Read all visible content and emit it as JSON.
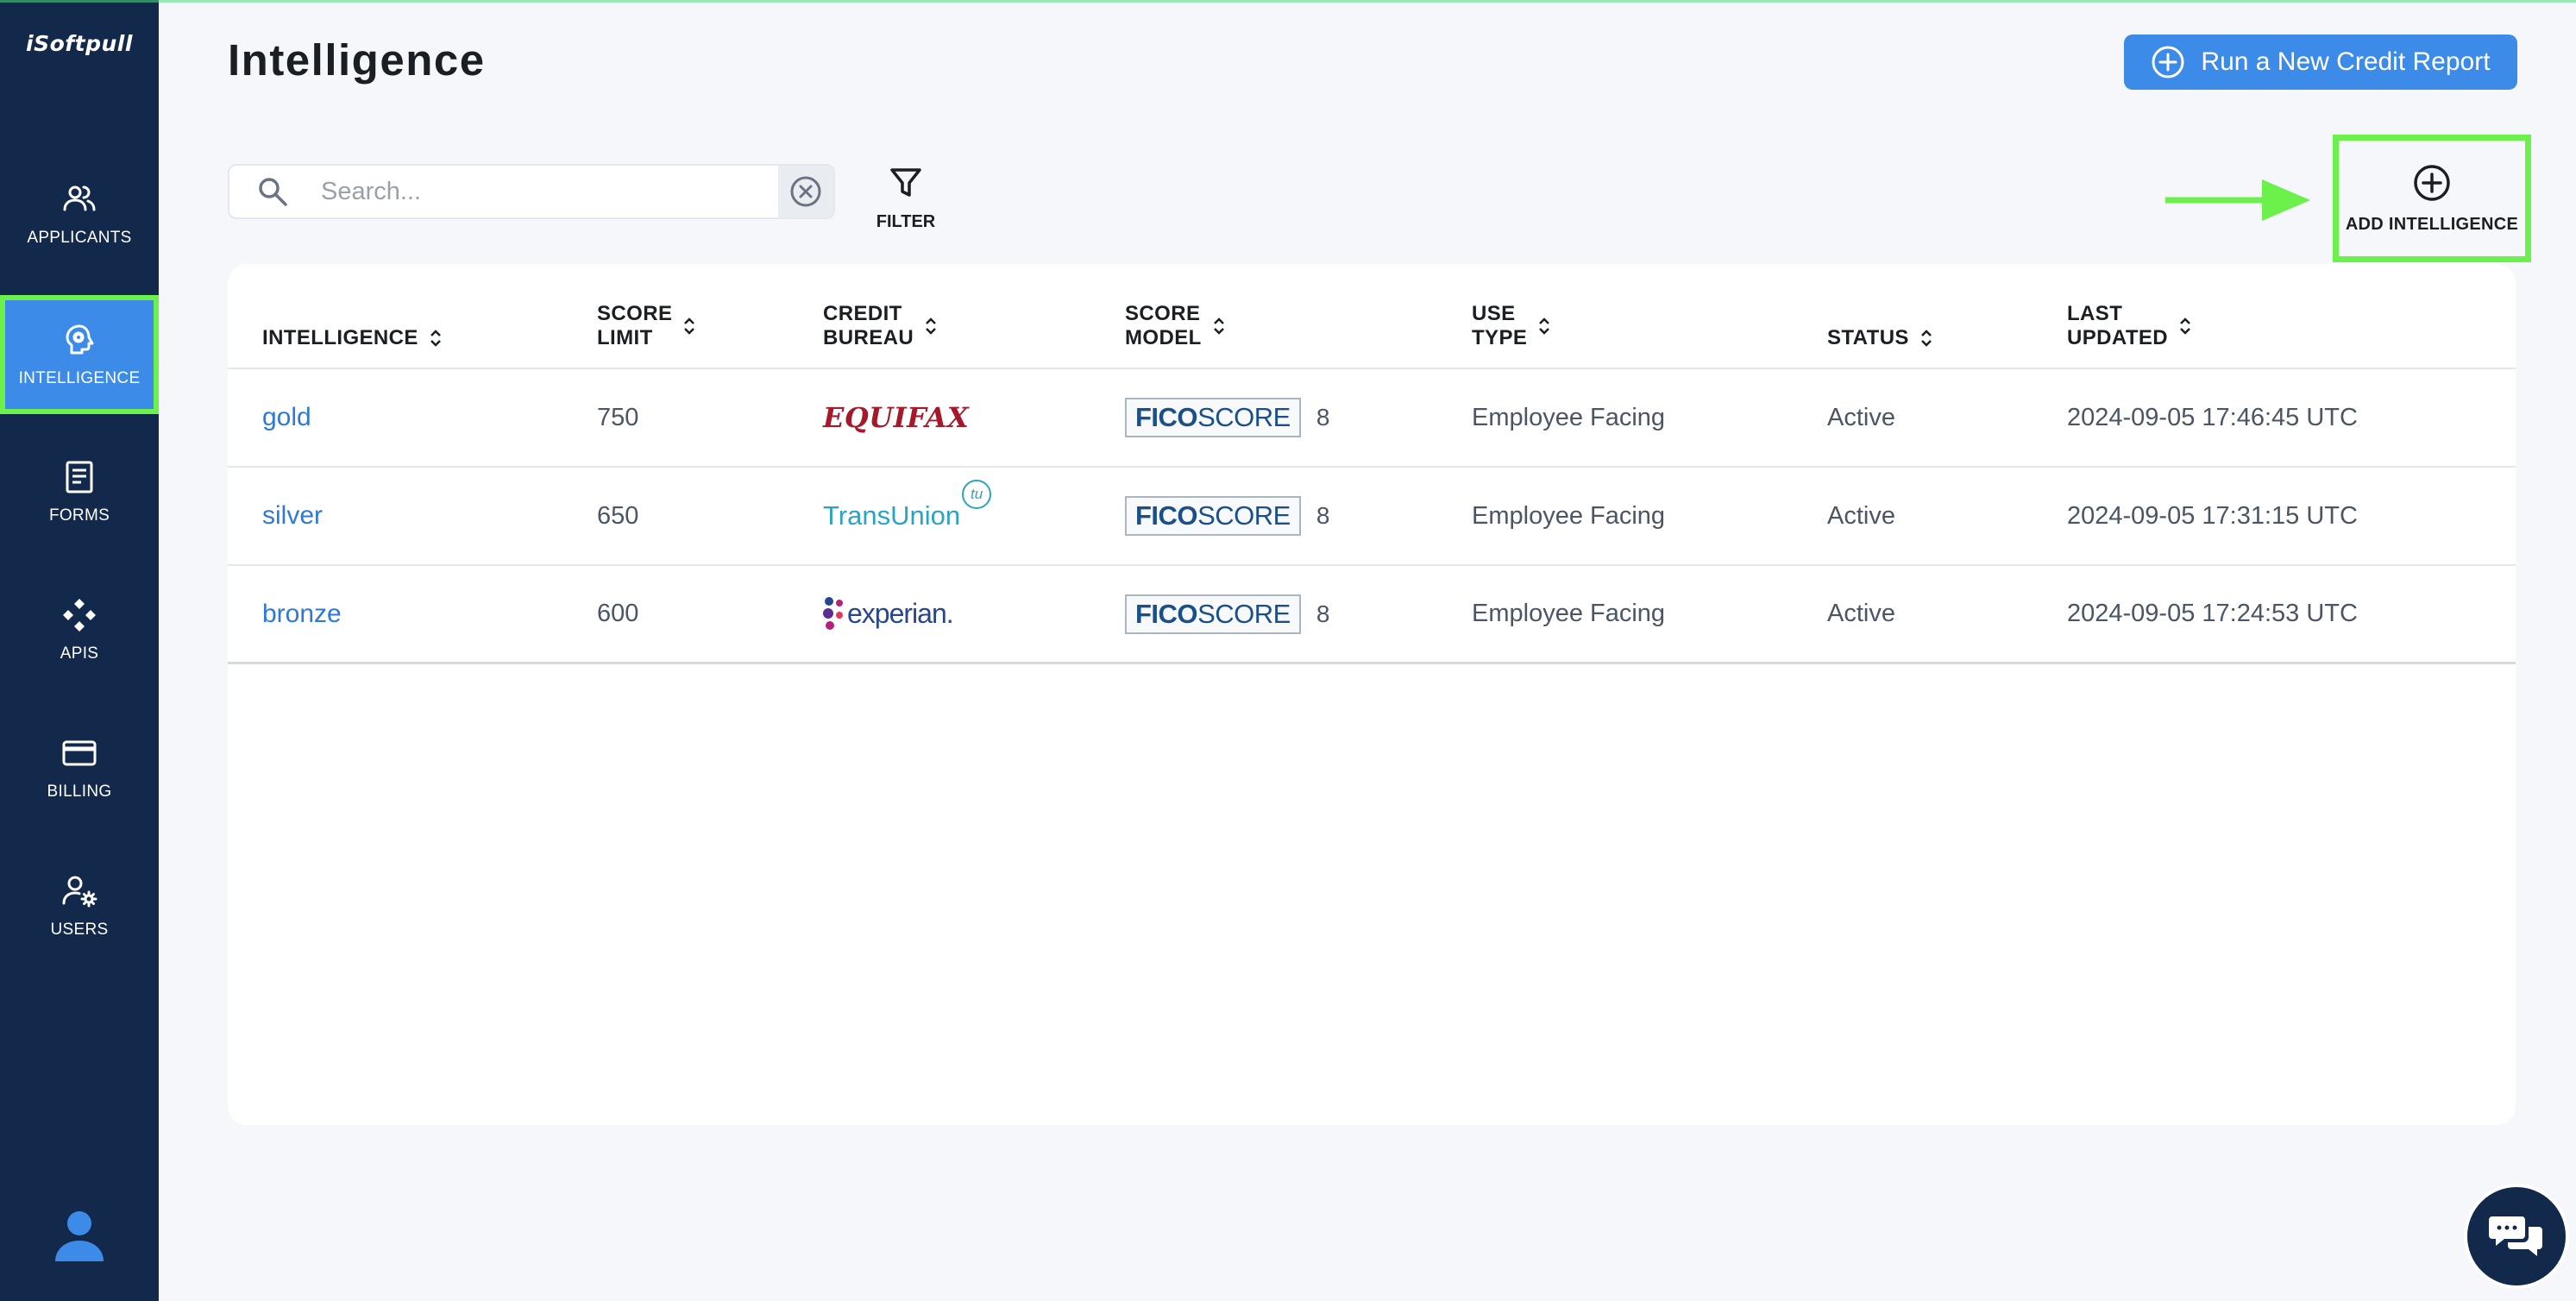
{
  "app": {
    "logo": "iSoftpull"
  },
  "sidebar": {
    "items": [
      {
        "label": "APPLICANTS",
        "icon": "people-icon"
      },
      {
        "label": "INTELLIGENCE",
        "icon": "brain-icon",
        "active": true
      },
      {
        "label": "FORMS",
        "icon": "document-icon"
      },
      {
        "label": "APIS",
        "icon": "api-icon"
      },
      {
        "label": "BILLING",
        "icon": "credit-card-icon"
      },
      {
        "label": "USERS",
        "icon": "user-gear-icon"
      }
    ],
    "profile_icon": "person-icon"
  },
  "header": {
    "title": "Intelligence",
    "run_report_label": "Run a New Credit Report"
  },
  "toolbar": {
    "search_placeholder": "Search...",
    "search_value": "",
    "filter_label": "FILTER",
    "add_label": "ADD INTELLIGENCE"
  },
  "table": {
    "columns": [
      {
        "line1": "INTELLIGENCE",
        "line2": ""
      },
      {
        "line1": "SCORE",
        "line2": "LIMIT"
      },
      {
        "line1": "CREDIT",
        "line2": "BUREAU"
      },
      {
        "line1": "SCORE",
        "line2": "MODEL"
      },
      {
        "line1": "USE",
        "line2": "TYPE"
      },
      {
        "line1": "STATUS",
        "line2": ""
      },
      {
        "line1": "LAST",
        "line2": "UPDATED"
      }
    ],
    "rows": [
      {
        "name": "gold",
        "score_limit": "750",
        "bureau": "EQUIFAX",
        "model_fico": "FICO",
        "model_score": "SCORE",
        "model_version": "8",
        "use_type": "Employee Facing",
        "status": "Active",
        "updated": "2024-09-05 17:46:45 UTC"
      },
      {
        "name": "silver",
        "score_limit": "650",
        "bureau": "TransUnion",
        "bureau_badge": "tu",
        "model_fico": "FICO",
        "model_score": "SCORE",
        "model_version": "8",
        "use_type": "Employee Facing",
        "status": "Active",
        "updated": "2024-09-05 17:31:15 UTC"
      },
      {
        "name": "bronze",
        "score_limit": "600",
        "bureau": "experian.",
        "model_fico": "FICO",
        "model_score": "SCORE",
        "model_version": "8",
        "use_type": "Employee Facing",
        "status": "Active",
        "updated": "2024-09-05 17:24:53 UTC"
      }
    ]
  },
  "colors": {
    "sidebar": "#13294b",
    "accent": "#3d8be8",
    "highlight": "#6cf04b",
    "link": "#2c7ad6",
    "equifax": "#a5192b",
    "transunion": "#2aa4c4",
    "experian": "#26478d"
  },
  "chat_icon": "chat-bubbles-icon"
}
